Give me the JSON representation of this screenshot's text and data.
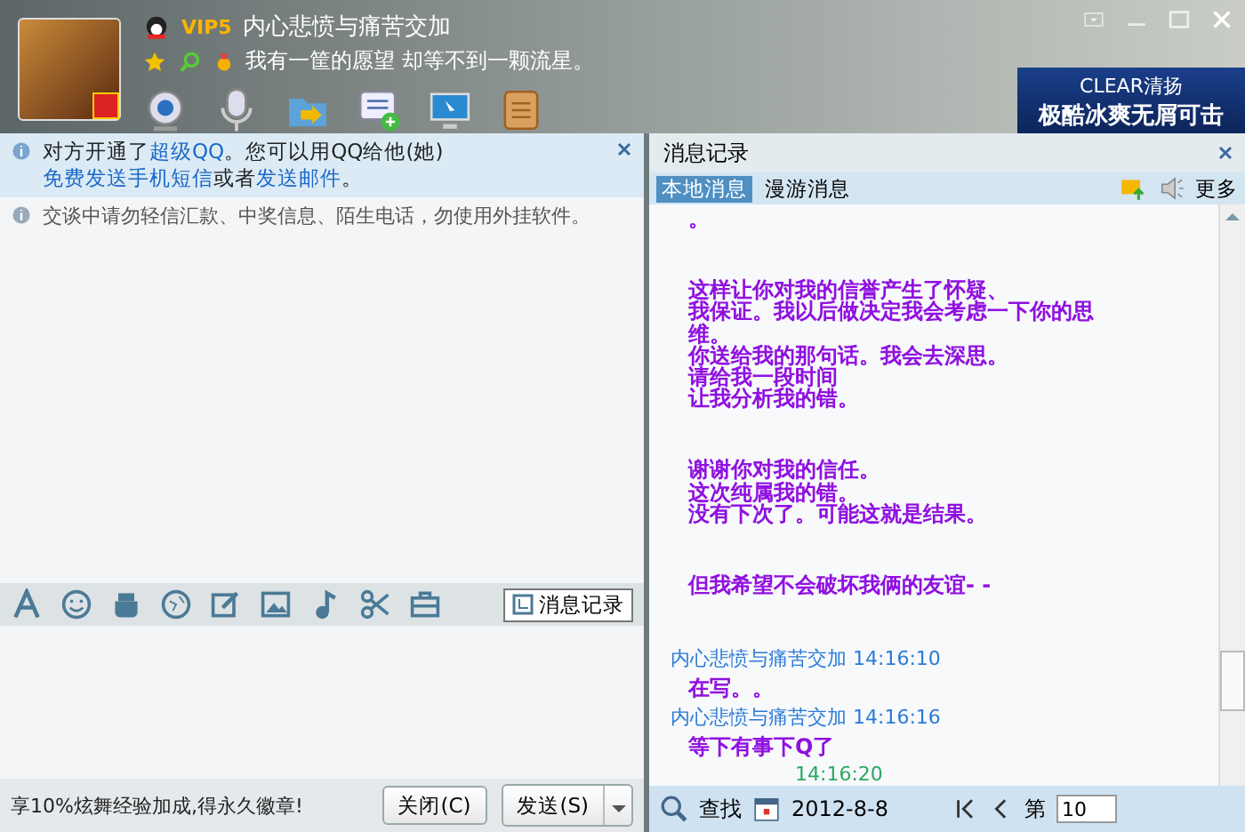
{
  "contact": {
    "vip": "VIP5",
    "name": "内心悲愤与痛苦交加",
    "signature": "我有一筐的愿望 却等不到一颗流星。"
  },
  "ad": {
    "brand": "CLEAR清扬",
    "slogan": "极酷冰爽无屑可击"
  },
  "notice": {
    "segments": [
      {
        "text": "对方开通了",
        "link": false
      },
      {
        "text": "超级QQ",
        "link": true
      },
      {
        "text": "。您可以用QQ给他(她)",
        "link": false
      },
      {
        "text": "免费发送手机短信",
        "link": true
      },
      {
        "text": "或者",
        "link": false
      },
      {
        "text": "发送邮件",
        "link": true
      },
      {
        "text": "。",
        "link": false
      }
    ]
  },
  "warning": "交谈中请勿轻信汇款、中奖信息、陌生电话，勿使用外挂软件。",
  "history_button": "消息记录",
  "promo": "享10%炫舞经验加成,得永久徽章!",
  "buttons": [
    {
      "kind": "close",
      "label": "关闭(C)"
    },
    {
      "kind": "send",
      "label": "发送(S)"
    }
  ],
  "history": {
    "title": "消息记录",
    "tabs": [
      {
        "label": "本地消息",
        "selected": true
      },
      {
        "label": "漫游消息",
        "selected": false
      }
    ],
    "more": "更多",
    "messages": [
      {
        "kind": "body",
        "lines": [
          "。"
        ]
      },
      {
        "kind": "body",
        "lines": [
          "这样让你对我的信誉产生了怀疑、",
          "我保证。我以后做决定我会考虑一下你的思",
          "维。",
          "你送给我的那句话。我会去深思。",
          "请给我一段时间",
          "让我分析我的错。"
        ]
      },
      {
        "kind": "body",
        "lines": [
          "谢谢你对我的信任。",
          "这次纯属我的错。",
          "没有下次了。可能这就是结果。"
        ]
      },
      {
        "kind": "body",
        "lines": [
          "但我希望不会破坏我俩的友谊- -"
        ]
      },
      {
        "kind": "sender",
        "name": "内心悲愤与痛苦交加",
        "time": "14:16:10"
      },
      {
        "kind": "reply",
        "lines": [
          "在写。。"
        ]
      },
      {
        "kind": "sender",
        "name": "内心悲愤与痛苦交加",
        "time": "14:16:16"
      },
      {
        "kind": "reply",
        "lines": [
          "等下有事下Q了"
        ]
      },
      {
        "kind": "time",
        "time": "14:16:20"
      }
    ],
    "search": "查找",
    "date": "2012-8-8",
    "page_label": "第",
    "page": "10"
  }
}
